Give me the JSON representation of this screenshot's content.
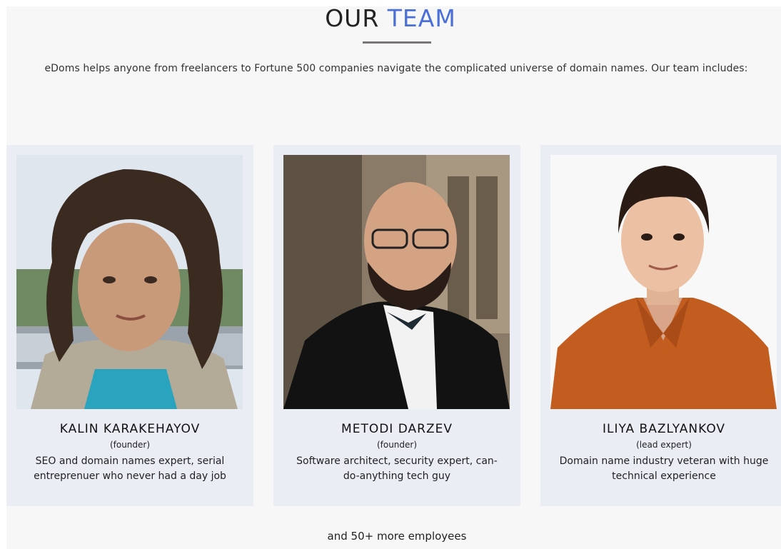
{
  "header": {
    "title_part1": "OUR",
    "title_part2": "TEAM",
    "accent_color": "#4a6fd8",
    "intro": "eDoms helps anyone from freelancers to Fortune 500 companies navigate the complicated universe of domain names. Our team includes:"
  },
  "team": [
    {
      "name": "KALIN KARAKEHAYOV",
      "role": "(founder)",
      "description": "SEO and domain names expert, serial entreprenuer who never had a day job",
      "photo_icon": "photo-kalin"
    },
    {
      "name": "METODI DARZEV",
      "role": "(founder)",
      "description": "Software architect, security expert, can-do-anything tech guy",
      "photo_icon": "photo-metodi"
    },
    {
      "name": "ILIYA BAZLYANKOV",
      "role": "(lead expert)",
      "description": "Domain name industry veteran with huge technical experience",
      "photo_icon": "photo-iliya"
    }
  ],
  "footer": {
    "more": "and 50+ more employees"
  }
}
